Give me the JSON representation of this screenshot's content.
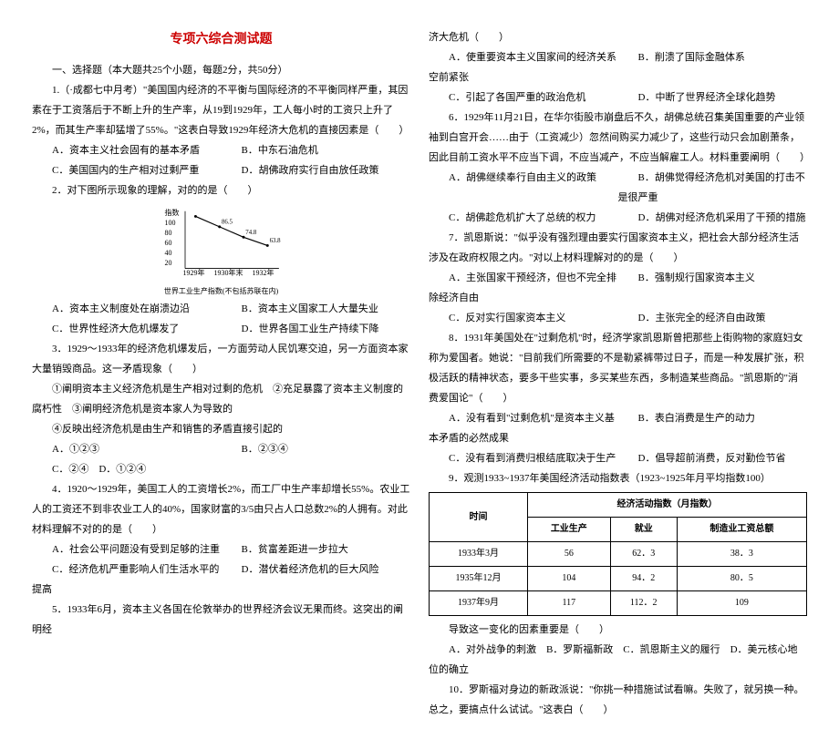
{
  "title": "专项六综合测试题",
  "section_heading": "一、选择题（本大题共25个小题，每题2分，共50分）",
  "q1": {
    "stem": "1.（·成都七中月考）\"美国国内经济的不平衡与国际经济的不平衡同样严重，其因素在于工资落后于不断上升的生产率，从19到1929年，工人每小时的工资只上升了2%，而其生产率却猛增了55%。\"这表白导致1929年经济大危机的直接因素是（　　）",
    "a": "A．资本主义社会固有的基本矛盾",
    "b": "B．中东石油危机",
    "c": "C．美国国内的生产相对过剩严重",
    "d": "D．胡佛政府实行自由放任政策"
  },
  "q2": {
    "stem": "2．对下图所示现象的理解，对的的是（　　）",
    "a": "A．资本主义制度处在崩溃边沿",
    "b": "B．资本主义国家工人大量失业",
    "c": "C．世界性经济大危机爆发了",
    "d": "D．世界各国工业生产持续下降"
  },
  "q3": {
    "stem": "3．1929～1933年的经济危机爆发后，一方面劳动人民饥寒交迫，另一方面资本家大量销毁商品。这一矛盾现象（　　）",
    "s1": "①阐明资本主义经济危机是生产相对过剩的危机　②充足暴露了资本主义制度的腐朽性　③阐明经济危机是资本家人为导致的",
    "s2": "④反映出经济危机是由生产和销售的矛盾直接引起的",
    "a": "A．①②③",
    "b": "B．②③④",
    "c": "C．②④　D．①②④"
  },
  "q4": {
    "stem": "4．1920～1929年，美国工人的工资增长2%，而工厂中生产率却增长55%。农业工人的工资还不到非农业工人的40%，国家财富的3/5由只占人口总数2%的人拥有。对此材料理解不对的的是（　　）",
    "a": "A．社会公平问题没有受到足够的注重",
    "b": "B．贫富差距进一步拉大",
    "c": "C．经济危机严重影响人们生活水平的提高",
    "d": "D．潜伏着经济危机的巨大风险"
  },
  "q5": {
    "stem": "5．1933年6月，资本主义各国在伦敦举办的世界经济会议无果而终。这突出的阐明经"
  },
  "q5b": {
    "stem_cont": "济大危机（　　）",
    "a": "A．使重要资本主义国家间的经济关系空前紧张",
    "b": "B．削溃了国际金融体系",
    "c": "C．引起了各国严重的政治危机",
    "d": "D．中断了世界经济全球化趋势"
  },
  "q6": {
    "stem": "6．1929年11月21日，在华尔街股市崩盘后不久，胡佛总统召集美国重要的产业领袖到白宫开会……由于（工资减少）忽然间购买力减少了，这些行动只会加剧萧条，因此目前工资水平不应当下调，不应当减产，不应当解雇工人。材料重要阐明（　　）",
    "a": "A．胡佛继续奉行自由主义的政策",
    "b": "B．胡佛觉得经济危机对美国的打击不是很严重",
    "c": "C．胡佛趁危机扩大了总统的权力",
    "d": "D．胡佛对经济危机采用了干预的措施"
  },
  "q7": {
    "stem": "7．凯恩斯说：\"似乎没有强烈理由要实行国家资本主义，把社会大部分经济生活涉及在政府权限之内。\"对以上材料理解对的的是（　　）",
    "a": "A．主张国家干预经济，但也不完全排除经济自由",
    "b": "B．强制规行国家资本主义",
    "c": "C．反对实行国家资本主义",
    "d": "D．主张完全的经济自由政策"
  },
  "q8": {
    "stem": "8．1931年美国处在\"过剩危机\"时，经济学家凯恩斯曾把那些上街购物的家庭妇女称为爱国者。她说：\"目前我们所需要的不是勒紧裤带过日子，而是一种发展扩张，积极活跃的精神状态，要多干些实事，多买某些东西，多制造某些商品。\"凯恩斯的\"消费爱国论\"（　　）",
    "a": "A．没有看到\"过剩危机\"是资本主义基本矛盾的必然成果",
    "b": "B．表白消费是生产的动力",
    "c": "C．没有看到消费归根结底取决于生产",
    "d": "D．倡导超前消费，反对勤俭节省"
  },
  "q9": {
    "stem": "9．观测1933~1937年美国经济活动指数表（1923~1925年月平均指数100）",
    "tail": "导致这一变化的因素重要是（　　）",
    "a": "A．对外战争的刺激　B．罗斯福新政　C．凯恩斯主义的履行　D．美元核心地位的确立"
  },
  "q10": {
    "stem": "10．罗斯福对身边的新政派说：\"你挑一种措施试试看嘛。失败了，就另换一种。总之，要搞点什么试试。\"这表白（　　）"
  },
  "table": {
    "headers": {
      "c1": "时间",
      "c2": "经济活动指数（月指数）",
      "s1": "工业生产",
      "s2": "就业",
      "s3": "制造业工资总额"
    },
    "rows": [
      {
        "t": "1933年3月",
        "v1": "56",
        "v2": "62．3",
        "v3": "38．3"
      },
      {
        "t": "1935年12月",
        "v1": "104",
        "v2": "94．2",
        "v3": "80．5"
      },
      {
        "t": "1937年9月",
        "v1": "117",
        "v2": "112．2",
        "v3": "109"
      }
    ]
  },
  "chart_data": {
    "type": "line",
    "x": [
      "1929年",
      "1930年",
      "1930年末",
      "1932年"
    ],
    "values": [
      100,
      86.5,
      74.8,
      63.8
    ],
    "ylim": [
      0,
      100
    ],
    "yticks": [
      100,
      80,
      60,
      40,
      20,
      0
    ],
    "ylabel_top": "指数",
    "caption": "世界工业生产指数(不包括苏联在内)"
  }
}
